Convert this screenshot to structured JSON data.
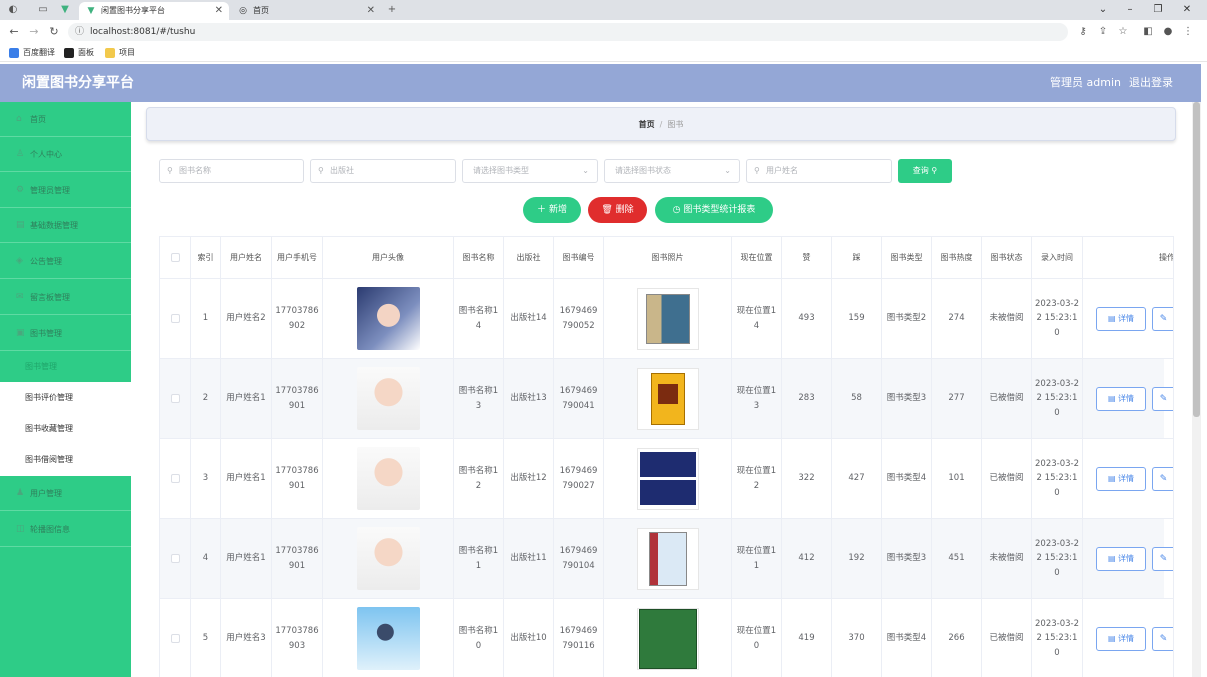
{
  "browser": {
    "tabs": [
      {
        "label": "闲置图书分享平台",
        "active": true
      },
      {
        "label": "首页",
        "active": false
      }
    ],
    "url": "localhost:8081/#/tushu",
    "bookmarks": [
      "百度翻译",
      "面板",
      "项目"
    ]
  },
  "header": {
    "title": "闲置图书分享平台",
    "user": "管理员 admin",
    "logout": "退出登录"
  },
  "sidebar": {
    "items": [
      {
        "label": "首页",
        "icon": "home-icon"
      },
      {
        "label": "个人中心",
        "icon": "user-icon"
      },
      {
        "label": "管理员管理",
        "icon": "admin-icon"
      },
      {
        "label": "基础数据管理",
        "icon": "data-icon"
      },
      {
        "label": "公告管理",
        "icon": "notice-icon"
      },
      {
        "label": "留言板管理",
        "icon": "message-icon"
      },
      {
        "label": "图书管理",
        "icon": "book-icon"
      }
    ],
    "subitems": [
      "图书管理",
      "图书评价管理",
      "图书收藏管理",
      "图书借阅管理"
    ],
    "after": [
      {
        "label": "用户管理",
        "icon": "users-icon"
      },
      {
        "label": "轮播图信息",
        "icon": "carousel-icon"
      }
    ]
  },
  "breadcrumb": {
    "home": "首页",
    "current": "图书"
  },
  "search": {
    "book_name_placeholder": "图书名称",
    "publisher_placeholder": "出版社",
    "type_placeholder": "请选择图书类型",
    "status_placeholder": "请选择图书状态",
    "username_placeholder": "用户姓名",
    "query_label": "查询"
  },
  "actions": {
    "add": "新增",
    "delete": "删除",
    "report": "图书类型统计报表"
  },
  "colors": {
    "primary": "#2ecc87",
    "danger": "#e02d2d",
    "header": "#94a7d6",
    "link": "#4a87e8"
  },
  "table": {
    "headers": [
      "索引",
      "用户姓名",
      "用户手机号",
      "用户头像",
      "图书名称",
      "出版社",
      "图书编号",
      "图书照片",
      "现在位置",
      "赞",
      "踩",
      "图书类型",
      "图书热度",
      "图书状态",
      "录入时间",
      "操作"
    ],
    "rows": [
      {
        "index": "1",
        "username": "用户姓名2",
        "phone": "17703786902",
        "avatar": "avatar-2",
        "book": "图书名称14",
        "publisher": "出版社14",
        "code": "1679469790052",
        "photo": "book-box-set",
        "location": "现在位置14",
        "like": "493",
        "dislike": "159",
        "type": "图书类型2",
        "heat": "274",
        "status": "未被借阅",
        "time": "2023-03-22 15:23:10"
      },
      {
        "index": "2",
        "username": "用户姓名1",
        "phone": "17703786901",
        "avatar": "avatar-1",
        "book": "图书名称13",
        "publisher": "出版社13",
        "code": "1679469790041",
        "photo": "book-yellow",
        "location": "现在位置13",
        "like": "283",
        "dislike": "58",
        "type": "图书类型3",
        "heat": "277",
        "status": "已被借阅",
        "time": "2023-03-22 15:23:10"
      },
      {
        "index": "3",
        "username": "用户姓名1",
        "phone": "17703786901",
        "avatar": "avatar-1",
        "book": "图书名称12",
        "publisher": "出版社12",
        "code": "1679469790027",
        "photo": "book-globe",
        "location": "现在位置12",
        "like": "322",
        "dislike": "427",
        "type": "图书类型4",
        "heat": "101",
        "status": "已被借阅",
        "time": "2023-03-22 15:23:10"
      },
      {
        "index": "4",
        "username": "用户姓名1",
        "phone": "17703786901",
        "avatar": "avatar-1",
        "book": "图书名称11",
        "publisher": "出版社11",
        "code": "1679469790104",
        "photo": "book-blue",
        "location": "现在位置11",
        "like": "412",
        "dislike": "192",
        "type": "图书类型3",
        "heat": "451",
        "status": "未被借阅",
        "time": "2023-03-22 15:23:10"
      },
      {
        "index": "5",
        "username": "用户姓名3",
        "phone": "17703786903",
        "avatar": "avatar-3",
        "book": "图书名称10",
        "publisher": "出版社10",
        "code": "1679469790116",
        "photo": "book-green",
        "location": "现在位置10",
        "like": "419",
        "dislike": "370",
        "type": "图书类型4",
        "heat": "266",
        "status": "已被借阅",
        "time": "2023-03-22 15:23:10"
      }
    ],
    "detail_label": "详情"
  }
}
